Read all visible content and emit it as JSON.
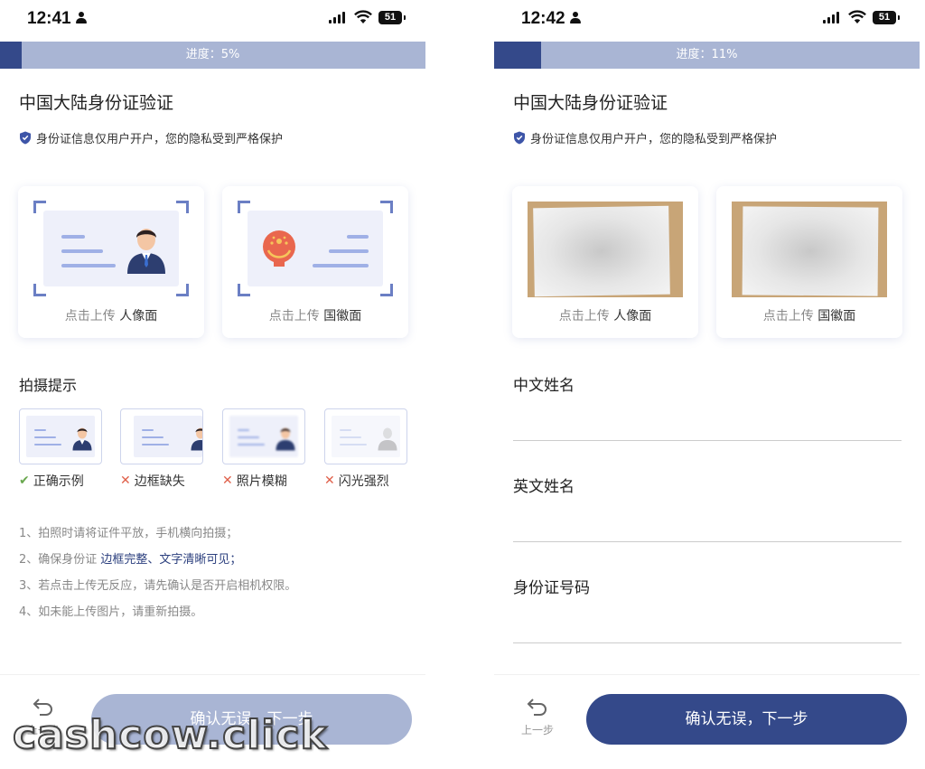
{
  "left": {
    "status": {
      "time": "12:41",
      "battery": "51"
    },
    "progress": {
      "label": "进度：5%",
      "value": 5
    },
    "title": "中国大陆身份证验证",
    "privacy": "身份证信息仅用户开户，您的隐私受到严格保护",
    "cards": [
      {
        "prefix": "点击上传",
        "side": "人像面"
      },
      {
        "prefix": "点击上传",
        "side": "国徽面"
      }
    ],
    "tips_title": "拍摄提示",
    "tips": [
      {
        "mark": "✔",
        "label": "正确示例"
      },
      {
        "mark": "✕",
        "label": "边框缺失"
      },
      {
        "mark": "✕",
        "label": "照片模糊"
      },
      {
        "mark": "✕",
        "label": "闪光强烈"
      }
    ],
    "notes": {
      "n1": "1、拍照时请将证件平放，手机横向拍摄；",
      "n2_pre": "2、确保身份证 ",
      "n2_hl": "边框完整、文字清晰可见；",
      "n3": "3、若点击上传无反应，请先确认是否开启相机权限。",
      "n4": "4、如未能上传图片，请重新拍摄。"
    },
    "back_label": "上一步",
    "next_label": "确认无误，下一步"
  },
  "right": {
    "status": {
      "time": "12:42",
      "battery": "51"
    },
    "progress": {
      "label": "进度：11%",
      "value": 11
    },
    "title": "中国大陆身份证验证",
    "privacy": "身份证信息仅用户开户，您的隐私受到严格保护",
    "cards": [
      {
        "prefix": "点击上传",
        "side": "人像面"
      },
      {
        "prefix": "点击上传",
        "side": "国徽面"
      }
    ],
    "fields": [
      {
        "label": "中文姓名",
        "value": ""
      },
      {
        "label": "英文姓名",
        "value": ""
      },
      {
        "label": "身份证号码",
        "value": ""
      }
    ],
    "back_label": "上一步",
    "next_label": "确认无误，下一步"
  },
  "watermark": "cashcow.click",
  "colors": {
    "primary": "#34498a",
    "primary_light": "#a9b5d4",
    "accent_line": "#9fb0e6",
    "ok": "#6aa84f",
    "bad": "#e0614b"
  }
}
